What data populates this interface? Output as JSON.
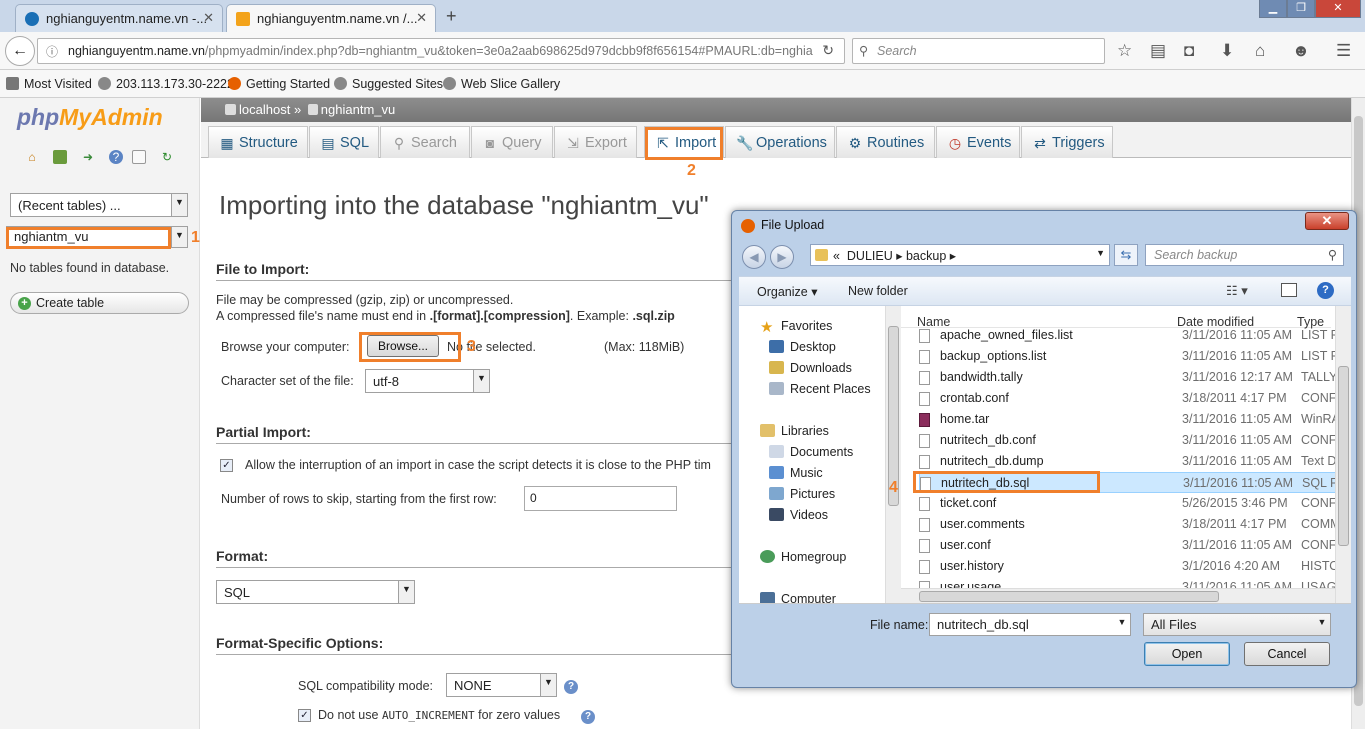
{
  "browser": {
    "tabs": [
      {
        "label": "nghianguyentm.name.vn -..."
      },
      {
        "label": "nghianguyentm.name.vn /..."
      }
    ],
    "url_host": "nghianguyentm.name.vn",
    "url_path": "/phpmyadmin/index.php?db=nghiantm_vu&token=3e0a2aab698625d979dcbb9f8f656154#PMAURL:db=nghia",
    "search_placeholder": "Search",
    "bookmarks": [
      "Most Visited",
      "203.113.173.30-2222",
      "Getting Started",
      "Suggested Sites",
      "Web Slice Gallery"
    ]
  },
  "sidebar": {
    "logo_php": "php",
    "logo_myadmin": "MyAdmin",
    "recent_tables": "(Recent tables) ...",
    "database_select": "nghiantm_vu",
    "no_tables": "No tables found in database.",
    "create_table": "Create table"
  },
  "breadcrumb": {
    "server": "localhost",
    "separator": "»",
    "database": "nghiantm_vu"
  },
  "tabs": [
    {
      "label": "Structure",
      "icon": "structure-icon"
    },
    {
      "label": "SQL",
      "icon": "sql-icon"
    },
    {
      "label": "Search",
      "icon": "search-icon"
    },
    {
      "label": "Query",
      "icon": "query-icon"
    },
    {
      "label": "Export",
      "icon": "export-icon"
    },
    {
      "label": "Import",
      "icon": "import-icon"
    },
    {
      "label": "Operations",
      "icon": "wrench-icon"
    },
    {
      "label": "Routines",
      "icon": "routines-icon"
    },
    {
      "label": "Events",
      "icon": "clock-icon"
    },
    {
      "label": "Triggers",
      "icon": "triggers-icon"
    }
  ],
  "import": {
    "heading": "Importing into the database \"nghiantm_vu\"",
    "file_section": "File to Import:",
    "compress_line1": "File may be compressed (gzip, zip) or uncompressed.",
    "compress_line2_a": "A compressed file's name must end in ",
    "compress_line2_b": ".[format].[compression]",
    "compress_line2_c": ". Example: ",
    "compress_line2_d": ".sql.zip",
    "browse_label": "Browse your computer:",
    "browse_button": "Browse...",
    "no_file": "No file selected.",
    "max_size": "(Max: 118MiB)",
    "charset_label": "Character set of the file:",
    "charset_value": "utf-8",
    "partial_section": "Partial Import:",
    "allow_interrupt": "Allow the interruption of an import in case the script detects it is close to the PHP tim",
    "skip_label": "Number of rows to skip, starting from the first row:",
    "skip_value": "0",
    "format_section": "Format:",
    "format_value": "SQL",
    "format_specific_section": "Format-Specific Options:",
    "compat_label": "SQL compatibility mode:",
    "compat_value": "NONE",
    "no_auto_a": "Do not use ",
    "no_auto_code": "AUTO_INCREMENT",
    "no_auto_b": " for zero values"
  },
  "steps": [
    "1",
    "2",
    "3",
    "4"
  ],
  "dialog": {
    "title": "File Upload",
    "path_prefix": "«",
    "path": [
      "DULIEU",
      "backup"
    ],
    "search_placeholder": "Search backup",
    "organize": "Organize",
    "new_folder": "New folder",
    "columns": {
      "name": "Name",
      "date": "Date modified",
      "type": "Type"
    },
    "nav": {
      "favorites": "Favorites",
      "desktop": "Desktop",
      "downloads": "Downloads",
      "recent": "Recent Places",
      "libraries": "Libraries",
      "documents": "Documents",
      "music": "Music",
      "pictures": "Pictures",
      "videos": "Videos",
      "homegroup": "Homegroup",
      "computer": "Computer"
    },
    "files": [
      {
        "name": "apache_owned_files.list",
        "date": "3/11/2016 11:05 AM",
        "type": "LIST Fi"
      },
      {
        "name": "backup_options.list",
        "date": "3/11/2016 11:05 AM",
        "type": "LIST Fi"
      },
      {
        "name": "bandwidth.tally",
        "date": "3/11/2016 12:17 AM",
        "type": "TALLY"
      },
      {
        "name": "crontab.conf",
        "date": "3/18/2011 4:17 PM",
        "type": "CONF"
      },
      {
        "name": "home.tar",
        "date": "3/11/2016 11:05 AM",
        "type": "WinRA"
      },
      {
        "name": "nutritech_db.conf",
        "date": "3/11/2016 11:05 AM",
        "type": "CONF"
      },
      {
        "name": "nutritech_db.dump",
        "date": "3/11/2016 11:05 AM",
        "type": "Text D"
      },
      {
        "name": "nutritech_db.sql",
        "date": "3/11/2016 11:05 AM",
        "type": "SQL Fi"
      },
      {
        "name": "ticket.conf",
        "date": "5/26/2015 3:46 PM",
        "type": "CONF"
      },
      {
        "name": "user.comments",
        "date": "3/18/2011 4:17 PM",
        "type": "COMM"
      },
      {
        "name": "user.conf",
        "date": "3/11/2016 11:05 AM",
        "type": "CONF"
      },
      {
        "name": "user.history",
        "date": "3/1/2016 4:20 AM",
        "type": "HISTO"
      },
      {
        "name": "user.usage",
        "date": "3/11/2016 11:05 AM",
        "type": "USAGE"
      }
    ],
    "filename_label": "File name:",
    "filename_value": "nutritech_db.sql",
    "filetype_value": "All Files",
    "open": "Open",
    "cancel": "Cancel"
  },
  "colors": {
    "accent": "#f07f2b",
    "link": "#235a81",
    "dialog_frame": "#bcd0e8"
  }
}
